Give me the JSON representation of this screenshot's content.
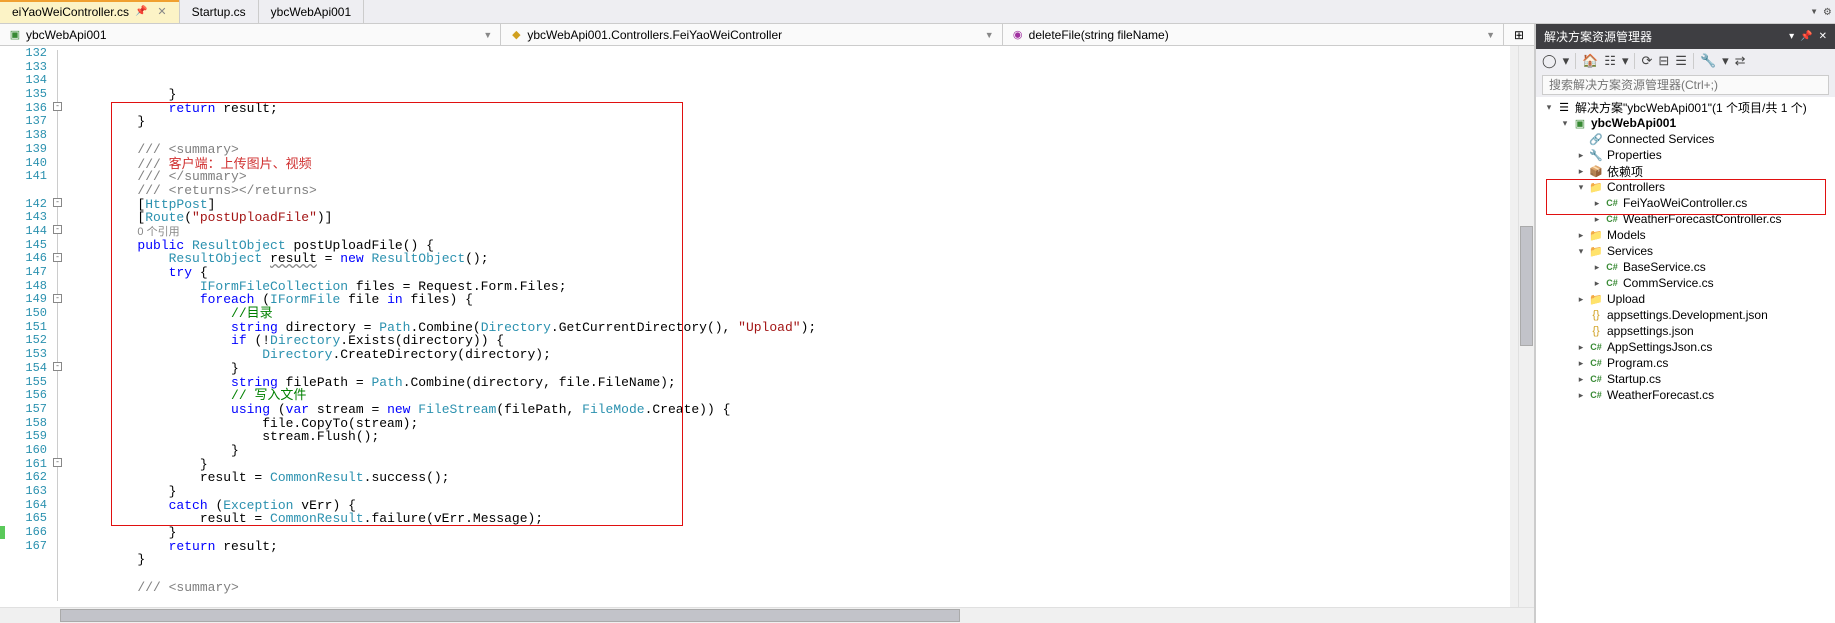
{
  "tabs": {
    "items": [
      {
        "label": "eiYaoWeiController.cs",
        "active": true,
        "pinned": true
      },
      {
        "label": "Startup.cs",
        "active": false
      },
      {
        "label": "ybcWebApi001",
        "active": false
      }
    ]
  },
  "nav": {
    "segment1": "ybcWebApi001",
    "segment2": "ybcWebApi001.Controllers.FeiYaoWeiController",
    "segment3": "deleteFile(string fileName)"
  },
  "line_start": 132,
  "code": [
    {
      "n": 132,
      "i": 3,
      "t": [
        [
          "",
          "}"
        ]
      ]
    },
    {
      "n": 133,
      "i": 3,
      "t": [
        [
          "kw",
          "return"
        ],
        [
          "",
          " result;"
        ]
      ]
    },
    {
      "n": 134,
      "i": 2,
      "t": [
        [
          "",
          "}"
        ]
      ]
    },
    {
      "n": 135,
      "i": 0,
      "t": [
        [
          "",
          ""
        ]
      ]
    },
    {
      "n": 136,
      "i": 2,
      "t": [
        [
          "xml",
          "/// <summary>"
        ]
      ]
    },
    {
      "n": 137,
      "i": 2,
      "t": [
        [
          "xml",
          "/// "
        ],
        [
          "cn",
          "客户端：上传图片、视频"
        ]
      ]
    },
    {
      "n": 138,
      "i": 2,
      "t": [
        [
          "xml",
          "/// </summary>"
        ]
      ]
    },
    {
      "n": 139,
      "i": 2,
      "t": [
        [
          "xml",
          "/// <returns></returns>"
        ]
      ]
    },
    {
      "n": 140,
      "i": 2,
      "t": [
        [
          "",
          "["
        ],
        [
          "type",
          "HttpPost"
        ],
        [
          "",
          "]"
        ]
      ]
    },
    {
      "n": 141,
      "i": 2,
      "t": [
        [
          "",
          "["
        ],
        [
          "type",
          "Route"
        ],
        [
          "",
          "("
        ],
        [
          "str",
          "\"postUploadFile\""
        ],
        [
          "",
          ")]"
        ]
      ]
    },
    {
      "n": "",
      "i": 2,
      "t": [
        [
          "ref",
          "0 个引用"
        ]
      ]
    },
    {
      "n": 142,
      "i": 2,
      "t": [
        [
          "kw",
          "public"
        ],
        [
          "",
          " "
        ],
        [
          "type",
          "ResultObject"
        ],
        [
          "",
          " postUploadFile() {"
        ]
      ]
    },
    {
      "n": 143,
      "i": 3,
      "t": [
        [
          "type",
          "ResultObject"
        ],
        [
          "",
          " "
        ],
        [
          "u",
          "result"
        ],
        [
          "",
          " = "
        ],
        [
          "kw",
          "new"
        ],
        [
          "",
          " "
        ],
        [
          "type",
          "ResultObject"
        ],
        [
          "",
          "();"
        ]
      ]
    },
    {
      "n": 144,
      "i": 3,
      "t": [
        [
          "kw",
          "try"
        ],
        [
          "",
          " {"
        ]
      ]
    },
    {
      "n": 145,
      "i": 4,
      "t": [
        [
          "type",
          "IFormFileCollection"
        ],
        [
          "",
          " files = Request.Form.Files;"
        ]
      ]
    },
    {
      "n": 146,
      "i": 4,
      "t": [
        [
          "kw",
          "foreach"
        ],
        [
          "",
          " ("
        ],
        [
          "type",
          "IFormFile"
        ],
        [
          "",
          " file "
        ],
        [
          "kw",
          "in"
        ],
        [
          "",
          " files) {"
        ]
      ]
    },
    {
      "n": 147,
      "i": 5,
      "t": [
        [
          "cmt",
          "//目录"
        ]
      ]
    },
    {
      "n": 148,
      "i": 5,
      "t": [
        [
          "kw",
          "string"
        ],
        [
          "",
          " directory = "
        ],
        [
          "type",
          "Path"
        ],
        [
          "",
          ".Combine("
        ],
        [
          "type",
          "Directory"
        ],
        [
          "",
          ".GetCurrentDirectory(), "
        ],
        [
          "str",
          "\"Upload\""
        ],
        [
          "",
          ");"
        ]
      ]
    },
    {
      "n": 149,
      "i": 5,
      "t": [
        [
          "kw",
          "if"
        ],
        [
          "",
          " (!"
        ],
        [
          "type",
          "Directory"
        ],
        [
          "",
          ".Exists(directory)) {"
        ]
      ]
    },
    {
      "n": 150,
      "i": 6,
      "t": [
        [
          "type",
          "Directory"
        ],
        [
          "",
          ".CreateDirectory(directory);"
        ]
      ]
    },
    {
      "n": 151,
      "i": 5,
      "t": [
        [
          "",
          "}"
        ]
      ]
    },
    {
      "n": 152,
      "i": 5,
      "t": [
        [
          "kw",
          "string"
        ],
        [
          "",
          " filePath = "
        ],
        [
          "type",
          "Path"
        ],
        [
          "",
          ".Combine(directory, file.FileName);"
        ]
      ]
    },
    {
      "n": 153,
      "i": 5,
      "t": [
        [
          "cmt",
          "// 写入文件"
        ]
      ]
    },
    {
      "n": 154,
      "i": 5,
      "t": [
        [
          "kw",
          "using"
        ],
        [
          "",
          " ("
        ],
        [
          "kw",
          "var"
        ],
        [
          "",
          " stream = "
        ],
        [
          "kw",
          "new"
        ],
        [
          "",
          " "
        ],
        [
          "type",
          "FileStream"
        ],
        [
          "",
          "(filePath, "
        ],
        [
          "type",
          "FileMode"
        ],
        [
          "",
          ".Create)) {"
        ]
      ]
    },
    {
      "n": 155,
      "i": 6,
      "t": [
        [
          "",
          "file.CopyTo(stream);"
        ]
      ]
    },
    {
      "n": 156,
      "i": 6,
      "t": [
        [
          "",
          "stream.Flush();"
        ]
      ]
    },
    {
      "n": 157,
      "i": 5,
      "t": [
        [
          "",
          "}"
        ]
      ]
    },
    {
      "n": 158,
      "i": 4,
      "t": [
        [
          "",
          "}"
        ]
      ]
    },
    {
      "n": 159,
      "i": 4,
      "t": [
        [
          "",
          "result = "
        ],
        [
          "type",
          "CommonResult"
        ],
        [
          "",
          ".success();"
        ]
      ]
    },
    {
      "n": 160,
      "i": 3,
      "t": [
        [
          "",
          "}"
        ]
      ]
    },
    {
      "n": 161,
      "i": 3,
      "t": [
        [
          "kw",
          "catch"
        ],
        [
          "",
          " ("
        ],
        [
          "type",
          "Exception"
        ],
        [
          "",
          " vErr) {"
        ]
      ]
    },
    {
      "n": 162,
      "i": 4,
      "t": [
        [
          "",
          "result = "
        ],
        [
          "type",
          "CommonResult"
        ],
        [
          "",
          ".failure(vErr.Message);"
        ]
      ]
    },
    {
      "n": 163,
      "i": 3,
      "t": [
        [
          "",
          "}"
        ]
      ]
    },
    {
      "n": 164,
      "i": 3,
      "t": [
        [
          "kw",
          "return"
        ],
        [
          "",
          " result;"
        ]
      ]
    },
    {
      "n": 165,
      "i": 2,
      "t": [
        [
          "",
          "}"
        ]
      ]
    },
    {
      "n": 166,
      "i": 0,
      "t": [
        [
          "",
          ""
        ]
      ]
    },
    {
      "n": 167,
      "i": 2,
      "t": [
        [
          "xml",
          "/// <summary>"
        ]
      ]
    }
  ],
  "panel": {
    "title": "解决方案资源管理器",
    "search_placeholder": "搜索解决方案资源管理器(Ctrl+;)",
    "sln_label": "解决方案\"ybcWebApi001\"(1 个项目/共 1 个)"
  },
  "tree_rows": [
    {
      "depth": 0,
      "arrow": "▾",
      "icon": "sln",
      "label": "解决方案\"ybcWebApi001\"(1 个项目/共 1 个)"
    },
    {
      "depth": 1,
      "arrow": "▾",
      "icon": "csproj",
      "label": "ybcWebApi001",
      "bold": true
    },
    {
      "depth": 2,
      "arrow": "",
      "icon": "link",
      "label": "Connected Services"
    },
    {
      "depth": 2,
      "arrow": "▸",
      "icon": "wrench",
      "label": "Properties"
    },
    {
      "depth": 2,
      "arrow": "▸",
      "icon": "pkg",
      "label": "依赖项"
    },
    {
      "depth": 2,
      "arrow": "▾",
      "icon": "folder",
      "label": "Controllers"
    },
    {
      "depth": 3,
      "arrow": "▸",
      "icon": "cs",
      "label": "FeiYaoWeiController.cs"
    },
    {
      "depth": 3,
      "arrow": "▸",
      "icon": "cs",
      "label": "WeatherForecastController.cs"
    },
    {
      "depth": 2,
      "arrow": "▸",
      "icon": "folder",
      "label": "Models"
    },
    {
      "depth": 2,
      "arrow": "▾",
      "icon": "folder",
      "label": "Services"
    },
    {
      "depth": 3,
      "arrow": "▸",
      "icon": "cs",
      "label": "BaseService.cs"
    },
    {
      "depth": 3,
      "arrow": "▸",
      "icon": "cs",
      "label": "CommService.cs"
    },
    {
      "depth": 2,
      "arrow": "▸",
      "icon": "folder",
      "label": "Upload"
    },
    {
      "depth": 2,
      "arrow": "",
      "icon": "json",
      "label": "appsettings.Development.json"
    },
    {
      "depth": 2,
      "arrow": "",
      "icon": "json",
      "label": "appsettings.json"
    },
    {
      "depth": 2,
      "arrow": "▸",
      "icon": "cs",
      "label": "AppSettingsJson.cs"
    },
    {
      "depth": 2,
      "arrow": "▸",
      "icon": "cs",
      "label": "Program.cs"
    },
    {
      "depth": 2,
      "arrow": "▸",
      "icon": "cs",
      "label": "Startup.cs"
    },
    {
      "depth": 2,
      "arrow": "▸",
      "icon": "cs",
      "label": "WeatherForecast.cs"
    }
  ]
}
